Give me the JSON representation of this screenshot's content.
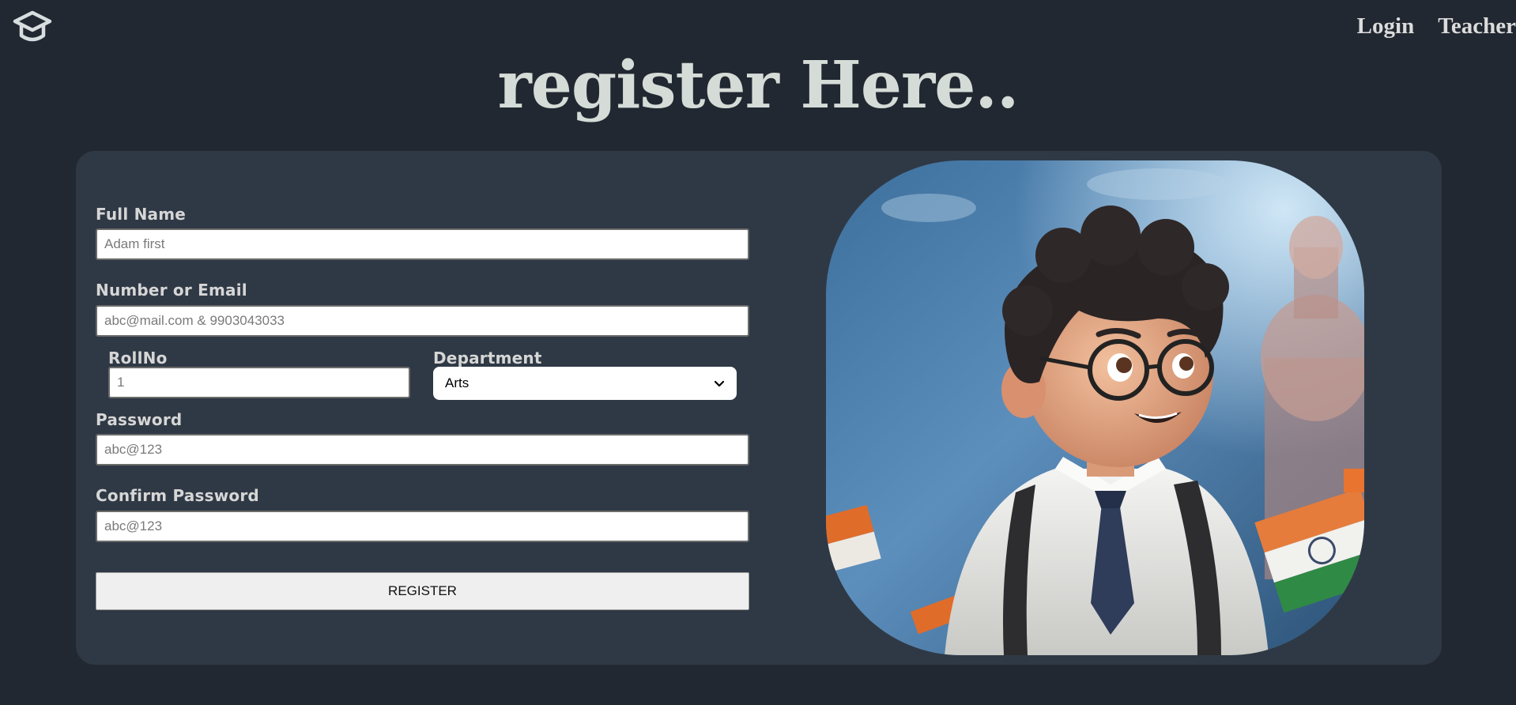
{
  "nav": {
    "login": "Login",
    "teacher": "Teacher"
  },
  "page": {
    "title": "register Here.."
  },
  "form": {
    "full_name": {
      "label": "Full Name",
      "placeholder": "Adam first"
    },
    "contact": {
      "label": "Number or Email",
      "placeholder": "abc@mail.com & 9903043033"
    },
    "roll_no": {
      "label": "RollNo",
      "placeholder": "1"
    },
    "department": {
      "label": "Department",
      "selected": "Arts"
    },
    "password": {
      "label": "Password",
      "placeholder": "abc@123"
    },
    "confirm_password": {
      "label": "Confirm Password",
      "placeholder": "abc@123"
    },
    "submit_label": "REGISTER"
  },
  "icons": {
    "logo": "graduation-cap-icon",
    "dropdown": "chevron-down-icon"
  },
  "colors": {
    "background": "#222831",
    "card": "#2f3945",
    "title": "#d5dbd6",
    "text": "#d6d6d6"
  }
}
